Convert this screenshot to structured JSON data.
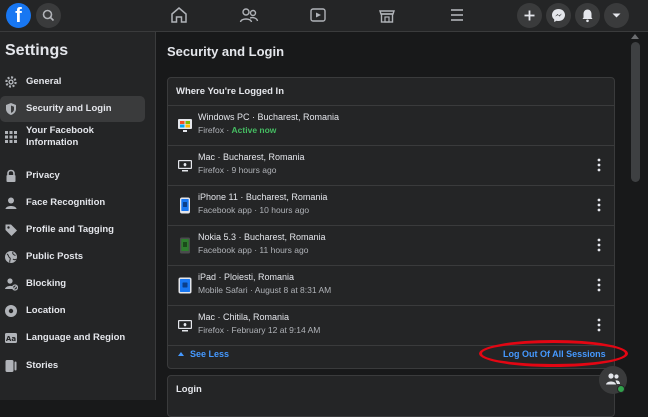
{
  "app": {
    "logo_letter": "f"
  },
  "sidebar": {
    "title": "Settings",
    "items": [
      {
        "label": "General",
        "icon": "gear-icon"
      },
      {
        "label": "Security and Login",
        "icon": "shield-icon",
        "active": true
      },
      {
        "label": "Your Facebook Information",
        "icon": "grid-icon"
      },
      {
        "label": "Privacy",
        "icon": "lock-icon"
      },
      {
        "label": "Face Recognition",
        "icon": "face-icon"
      },
      {
        "label": "Profile and Tagging",
        "icon": "tag-icon"
      },
      {
        "label": "Public Posts",
        "icon": "globe-icon"
      },
      {
        "label": "Blocking",
        "icon": "block-icon"
      },
      {
        "label": "Location",
        "icon": "location-icon"
      },
      {
        "label": "Language and Region",
        "icon": "language-icon"
      },
      {
        "label": "Stories",
        "icon": "stories-icon"
      }
    ]
  },
  "main": {
    "title": "Security and Login",
    "logged_in": {
      "header": "Where You're Logged In",
      "sessions": [
        {
          "device": "Windows PC · Bucharest, Romania",
          "detail": "Firefox · ",
          "status": "Active now",
          "icon": "windows-pc-icon"
        },
        {
          "device": "Mac · Bucharest, Romania",
          "detail": "Firefox · 9 hours ago",
          "icon": "mac-icon"
        },
        {
          "device": "iPhone 11 · Bucharest, Romania",
          "detail": "Facebook app · 10 hours ago",
          "icon": "iphone-icon"
        },
        {
          "device": "Nokia 5.3 · Bucharest, Romania",
          "detail": "Facebook app · 11 hours ago",
          "icon": "android-phone-icon"
        },
        {
          "device": "iPad · Ploiesti, Romania",
          "detail": "Mobile Safari · August 8 at 8:31 AM",
          "icon": "ipad-icon"
        },
        {
          "device": "Mac · Chitila, Romania",
          "detail": "Firefox · February 12 at 9:14 AM",
          "icon": "mac-icon"
        }
      ],
      "see_less": "See Less",
      "logout_all": "Log Out Of All Sessions"
    },
    "login_section": {
      "title": "Login"
    }
  },
  "colors": {
    "accent": "#1877f2",
    "link": "#4599ff",
    "active_green": "#45bd62",
    "highlight_red": "#e30613"
  }
}
